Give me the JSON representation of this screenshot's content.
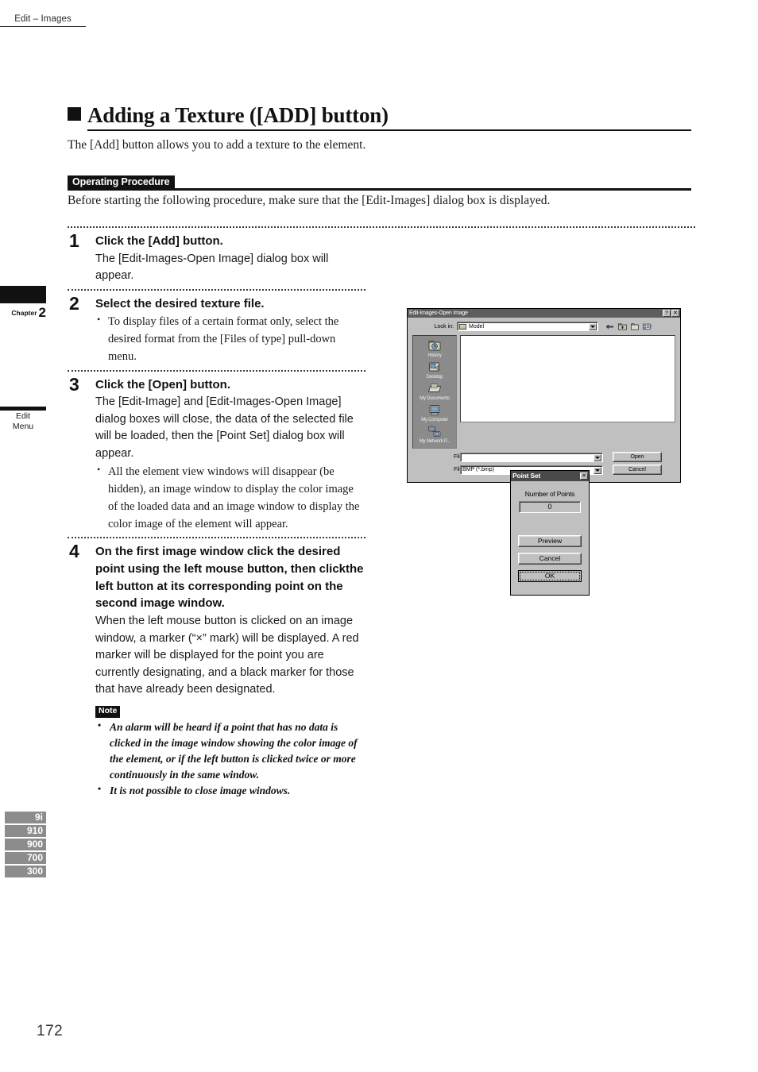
{
  "header": {
    "running_head": "Edit – Images"
  },
  "margin": {
    "chapter_word": "Chapter",
    "chapter_number": "2",
    "section_line1": "Edit",
    "section_line2": "Menu",
    "model_tabs": [
      "9i",
      "910",
      "900",
      "700",
      "300"
    ]
  },
  "page": {
    "number": "172"
  },
  "main": {
    "heading": "Adding a Texture ([ADD] button)",
    "intro": "The [Add] button allows you to add a texture to the element.",
    "op_badge": "Operating Procedure",
    "op_note": "Before starting the following procedure, make sure that the [Edit-Images] dialog box is displayed."
  },
  "steps": [
    {
      "number": "1",
      "title": "Click the [Add] button.",
      "body": "The [Edit-Images-Open Image] dialog box will appear.",
      "bullets": []
    },
    {
      "number": "2",
      "title": "Select the desired texture file.",
      "body": "",
      "bullets": [
        "To display files of a certain format only, select the desired format from the [Files of type] pull-down menu."
      ]
    },
    {
      "number": "3",
      "title": "Click the [Open] button.",
      "body": "The [Edit-Image] and [Edit-Images-Open Image] dialog boxes will close, the data of the selected file will be loaded, then the [Point Set] dialog box will appear.",
      "bullets": [
        "All the element view windows will disappear (be hidden), an image window to display the color image of the loaded data and an image window to display the color image of the element will appear."
      ]
    },
    {
      "number": "4",
      "title": "On the first image window click the desired point using the left mouse button, then clickthe left button at its corresponding point on the second image window.",
      "body": "When the left mouse button is clicked on an image window, a marker (“×” mark) will be displayed. A red marker will be displayed for the point you are currently designating, and a black marker for those that have already been designated.",
      "bullets": []
    }
  ],
  "note": {
    "badge": "Note",
    "items": [
      "An alarm will be heard if a point that has no data is clicked in the image window showing the color image of the element, or if the left button is clicked twice or more continuously in the same window.",
      "It is not possible to close image windows."
    ]
  },
  "dialog_open": {
    "title": "Edit-Images-Open Image",
    "help_button": "?",
    "close_button": "✕",
    "lookin_label": "Look in:",
    "lookin_value": "Model",
    "toolbar_icons": [
      "back-icon",
      "up-one-level-icon",
      "new-folder-icon",
      "views-icon"
    ],
    "places": [
      {
        "label": "History",
        "icon": "history-folder-icon"
      },
      {
        "label": "Desktop",
        "icon": "desktop-icon"
      },
      {
        "label": "My Documents",
        "icon": "my-documents-icon"
      },
      {
        "label": "My Computer",
        "icon": "my-computer-icon"
      },
      {
        "label": "My Network P...",
        "icon": "network-places-icon"
      }
    ],
    "filename_label": "File name:",
    "filename_value": "",
    "filetype_label": "Files of type:",
    "filetype_value": "BMP (*.bmp)",
    "open_button": "Open",
    "cancel_button": "Cancel"
  },
  "dialog_pointset": {
    "title": "Point Set",
    "close_button": "✕",
    "field_label": "Number of Points",
    "field_value": "0",
    "preview_button": "Preview",
    "cancel_button": "Cancel",
    "ok_button": "OK"
  }
}
